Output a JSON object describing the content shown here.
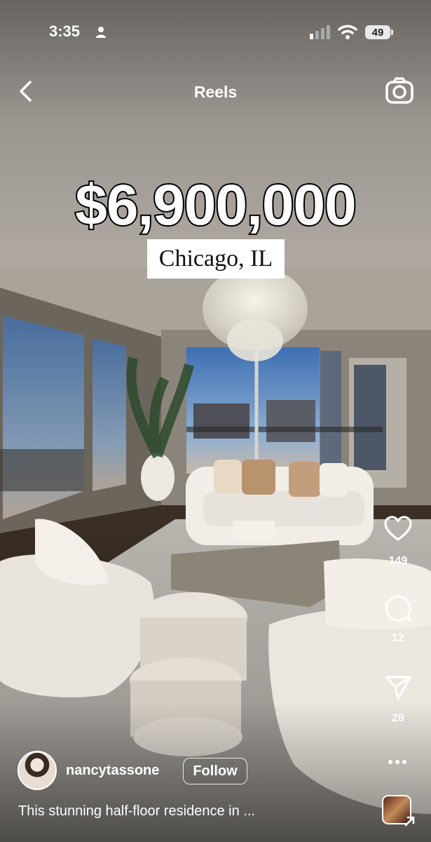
{
  "status_bar": {
    "time": "3:35",
    "battery": "49"
  },
  "header": {
    "title": "Reels"
  },
  "overlay": {
    "price": "$6,900,000",
    "location": "Chicago, IL"
  },
  "actions": {
    "likes": "149",
    "comments": "12",
    "shares": "28"
  },
  "post": {
    "username": "nancytassone",
    "follow_label": "Follow",
    "caption": "This stunning half-floor residence in ..."
  },
  "icons": [
    "person-icon",
    "signal-icon",
    "wifi-icon",
    "back-icon",
    "camera-icon",
    "heart-icon",
    "comment-icon",
    "share-icon",
    "more-icon",
    "audio-icon"
  ]
}
